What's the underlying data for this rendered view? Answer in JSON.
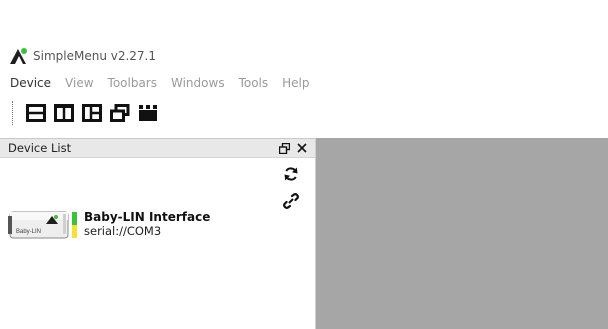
{
  "app": {
    "title": "SimpleMenu v2.27.1",
    "logo_icon": "babylin-logo-icon"
  },
  "menu": {
    "items": [
      {
        "label": "Device",
        "active": true
      },
      {
        "label": "View",
        "active": false
      },
      {
        "label": "Toolbars",
        "active": false
      },
      {
        "label": "Windows",
        "active": false
      },
      {
        "label": "Tools",
        "active": false
      },
      {
        "label": "Help",
        "active": false
      }
    ]
  },
  "toolbar": {
    "buttons": [
      {
        "icon": "layout-horizontal-split-icon"
      },
      {
        "icon": "layout-vertical-split-icon"
      },
      {
        "icon": "layout-grid-icon"
      },
      {
        "icon": "layout-float-icon"
      },
      {
        "icon": "layout-tabbed-icon"
      }
    ]
  },
  "device_list": {
    "title": "Device List",
    "refresh_icon": "refresh-icon",
    "connect_icon": "link-icon",
    "devices": [
      {
        "name": "Baby-LIN Interface",
        "address": "serial://COM3",
        "image_label": "Baby-LIN"
      }
    ]
  },
  "colors": {
    "workspace": "#a6a6a6",
    "panel_header": "#e8e8e8",
    "accent_green": "#3cc13c"
  }
}
